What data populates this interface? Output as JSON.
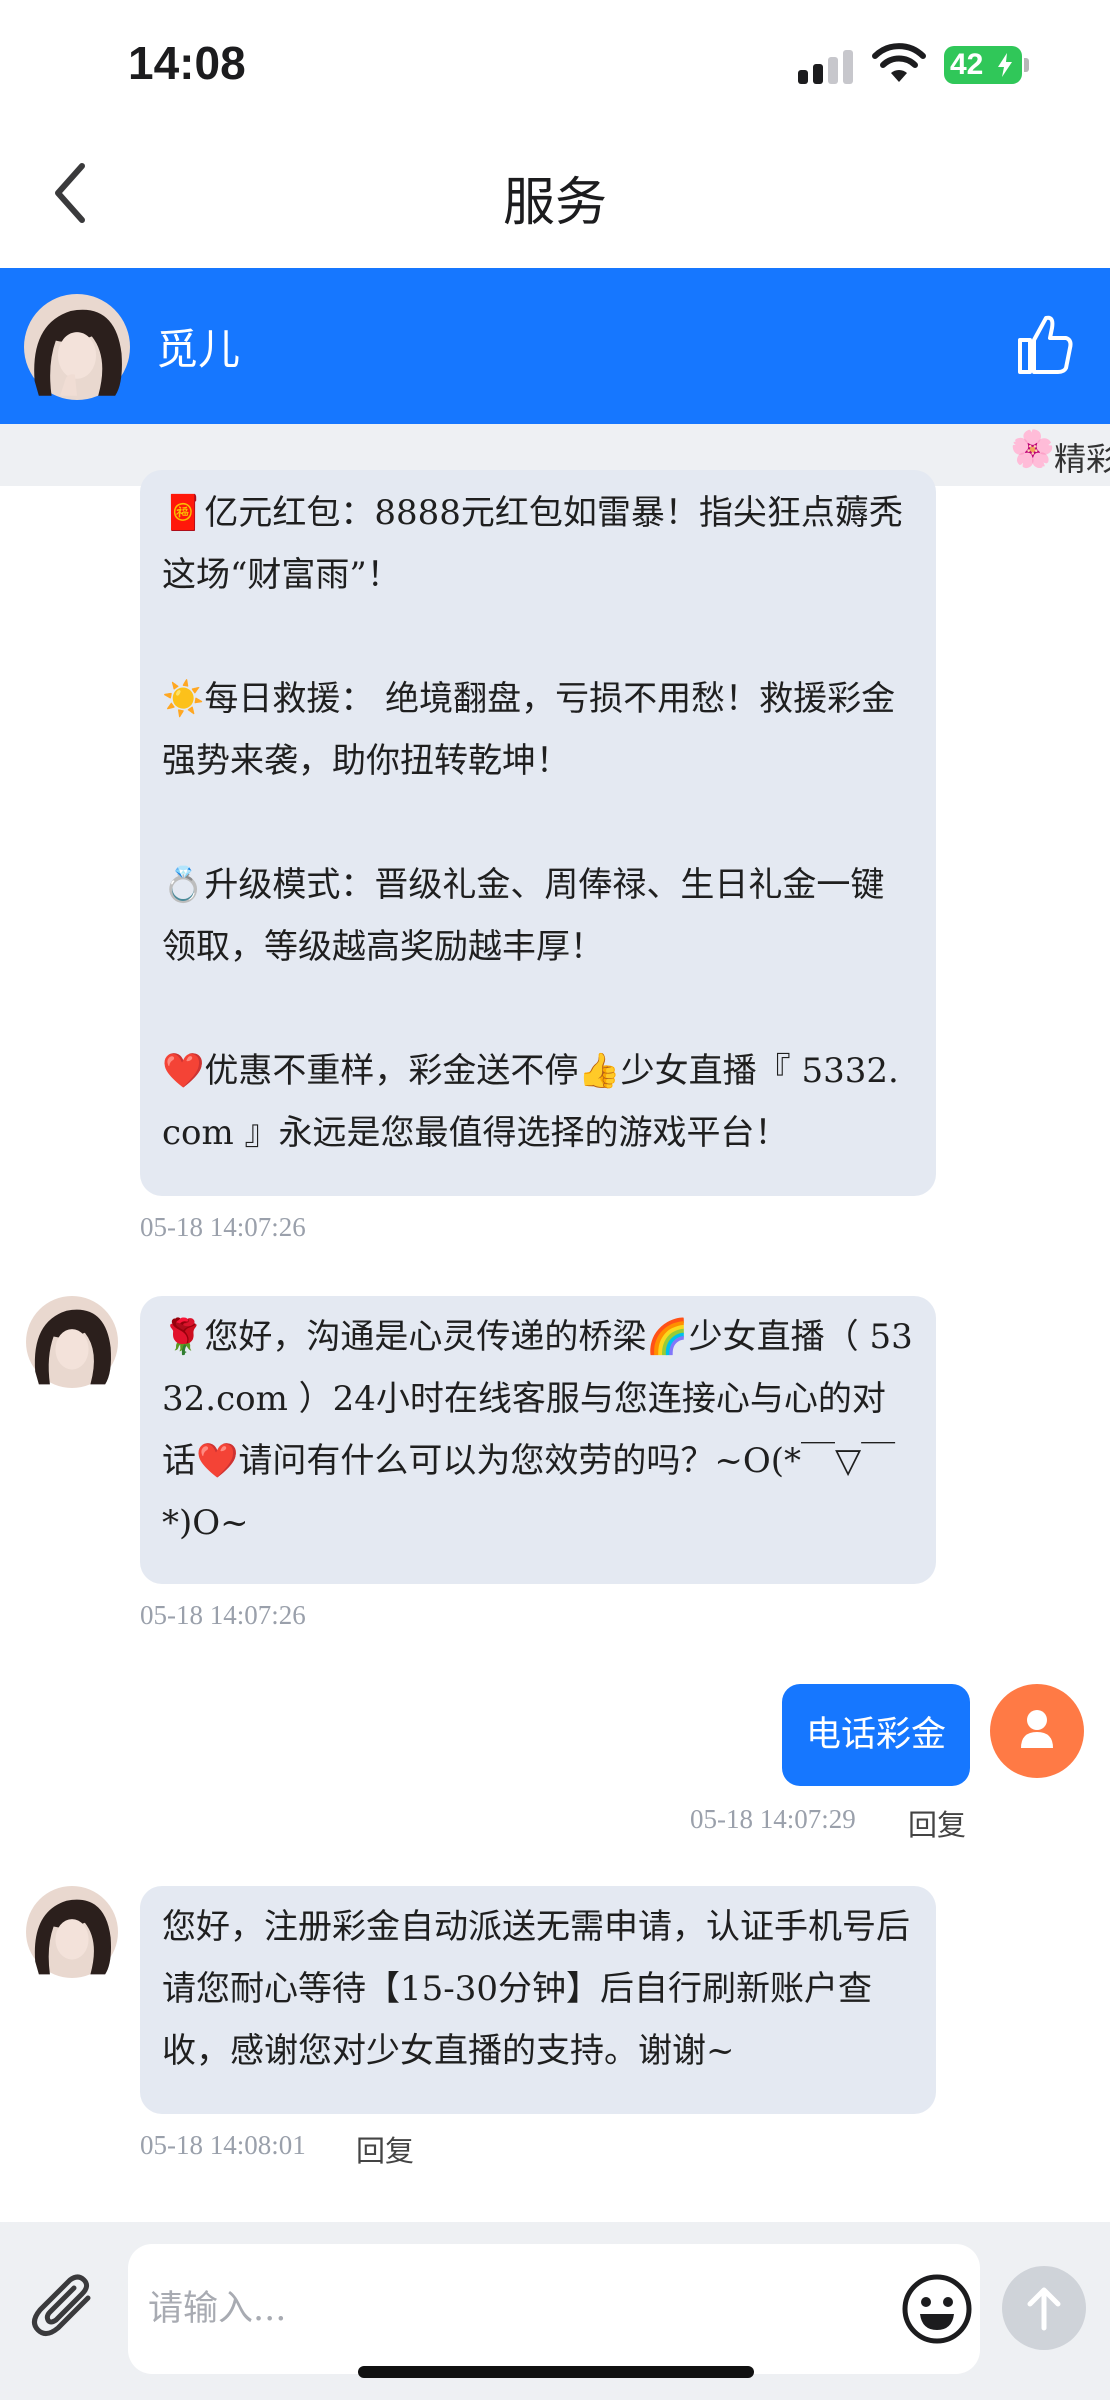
{
  "status_bar": {
    "time": "14:08",
    "battery": "42"
  },
  "nav": {
    "title": "服务"
  },
  "agent": {
    "name": "觅儿"
  },
  "marquee": {
    "text": "精彩"
  },
  "messages": [
    {
      "type": "incoming",
      "text": "🧧亿元红包：8888元红包如雷暴！指尖狂点薅秃这场“财富雨”！\n\n☀️每日救援： 绝境翻盘，亏损不用愁！救援彩金强势来袭，助你扭转乾坤！\n\n💍升级模式：晋级礼金、周俸禄、生日礼金一键领取，等级越高奖励越丰厚！\n\n❤️优惠不重样，彩金送不停👍少女直播『 5332.com 』永远是您最值得选择的游戏平台！",
      "timestamp": "05-18 14:07:26"
    },
    {
      "type": "incoming",
      "text": "🌹您好，沟通是心灵传递的桥梁🌈少女直播（ 5332.com ）24小时在线客服与您连接心与心的对话❤️请问有什么可以为您效劳的吗？~O(*￣▽￣*)O~",
      "timestamp": "05-18 14:07:26"
    },
    {
      "type": "outgoing",
      "text": "电话彩金",
      "timestamp": "05-18 14:07:29",
      "reply_label": "回复"
    },
    {
      "type": "incoming",
      "text": "您好，注册彩金自动派送无需申请，认证手机号后请您耐心等待【15-30分钟】后自行刷新账户查收，感谢您对少女直播的支持。谢谢~",
      "timestamp": "05-18 14:08:01",
      "reply_label": "回复"
    }
  ],
  "input": {
    "placeholder": "请输入..."
  },
  "colors": {
    "brand_blue": "#1677ff",
    "user_avatar": "#ff7a45",
    "bubble_incoming": "#e4e9f2"
  }
}
